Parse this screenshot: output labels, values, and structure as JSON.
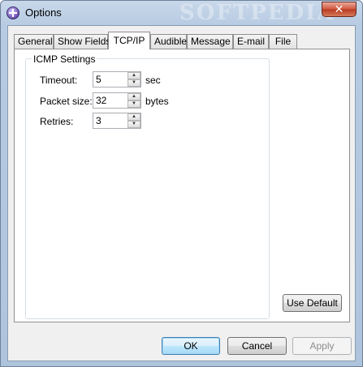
{
  "window": {
    "title": "Options",
    "watermark": "SOFTPEDIA"
  },
  "tabs": [
    {
      "label": "General"
    },
    {
      "label": "Show Fields"
    },
    {
      "label": "TCP/IP"
    },
    {
      "label": "Audible"
    },
    {
      "label": "Message"
    },
    {
      "label": "E-mail"
    },
    {
      "label": "File"
    }
  ],
  "active_tab": "TCP/IP",
  "icmp": {
    "group_label": "ICMP Settings",
    "timeout": {
      "label": "Timeout:",
      "value": "5",
      "unit": "sec"
    },
    "packet_size": {
      "label": "Packet size:",
      "value": "32",
      "unit": "bytes"
    },
    "retries": {
      "label": "Retries:",
      "value": "3"
    }
  },
  "buttons": {
    "use_default": "Use Default",
    "ok": "OK",
    "cancel": "Cancel",
    "apply": "Apply"
  },
  "icons": {
    "app": "options-app-icon",
    "close": "close-icon",
    "spin_up": "arrow-up-icon",
    "spin_down": "arrow-down-icon"
  }
}
